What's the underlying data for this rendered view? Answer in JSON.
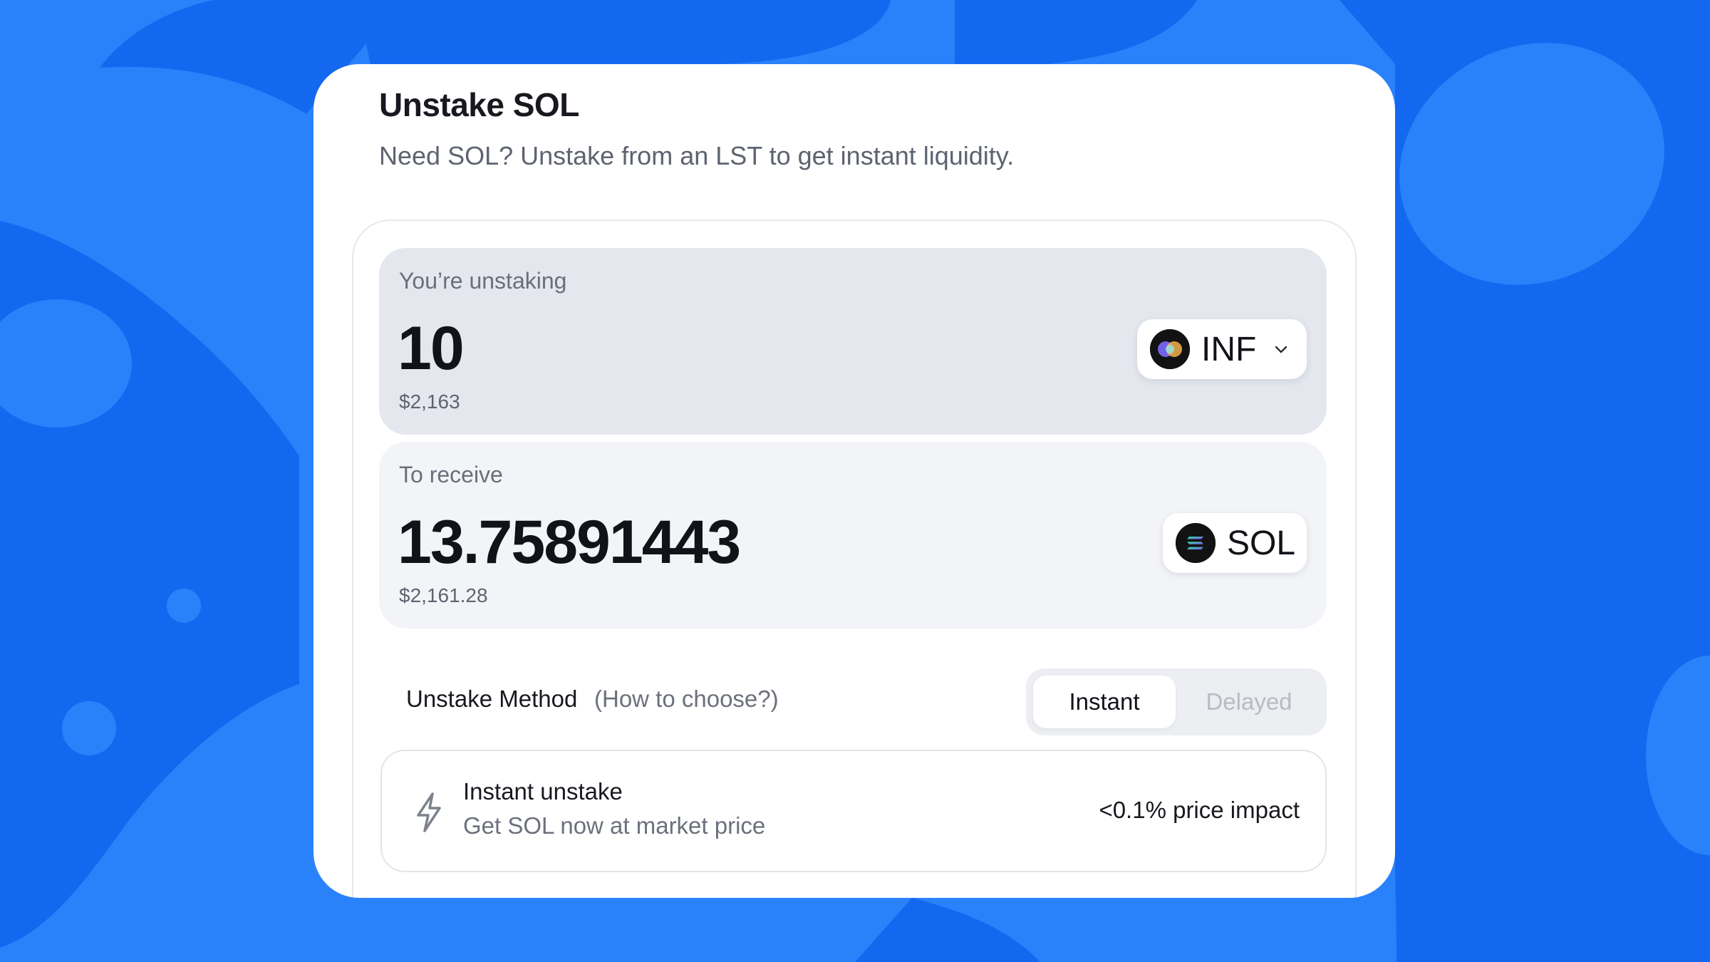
{
  "theme": {
    "background": "#2a82fb",
    "blob_dark": "#1468ef",
    "card": "#ffffff"
  },
  "card": {
    "title": "Unstake SOL",
    "subtitle": "Need SOL? Unstake from an LST to get instant liquidity."
  },
  "unstake": {
    "label": "You’re unstaking",
    "amount": "10",
    "usd": "$2,163",
    "token": {
      "symbol": "INF",
      "icon": "inf-token-icon"
    }
  },
  "receive": {
    "label": "To receive",
    "amount": "13.75891443",
    "usd": "$2,161.28",
    "token": {
      "symbol": "SOL",
      "icon": "sol-token-icon"
    }
  },
  "method": {
    "label": "Unstake Method",
    "help": "(How to choose?)",
    "options": [
      "Instant",
      "Delayed"
    ],
    "selected": "Instant"
  },
  "instant_info": {
    "icon": "lightning-bolt-icon",
    "title": "Instant unstake",
    "subtitle": "Get SOL now at market price",
    "impact": "<0.1% price impact"
  }
}
